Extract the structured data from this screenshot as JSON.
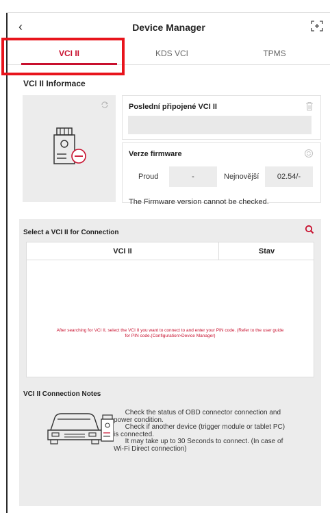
{
  "header": {
    "title": "Device Manager",
    "back_glyph": "‹",
    "icons": {
      "back": "back-chevron-icon",
      "expand": "expand-screen-icon"
    }
  },
  "tabs": [
    {
      "label": "VCI II",
      "active": true
    },
    {
      "label": "KDS VCI",
      "active": false
    },
    {
      "label": "TPMS",
      "active": false
    }
  ],
  "info_section": {
    "title": "VCI II Informace",
    "last_connected": {
      "title": "Poslední připojené VCI II",
      "value": ""
    },
    "firmware": {
      "title": "Verze firmware",
      "current_label": "Proud",
      "current_value": "-",
      "latest_label": "Nejnovější",
      "latest_value": "02.54/-",
      "note": "The Firmware version cannot be checked."
    }
  },
  "select_section": {
    "title": "Select a VCI II for Connection",
    "columns": [
      "VCI II",
      "Stav"
    ],
    "empty_message_line1": "After searching for VCI II, select the VCI II you want to connect to and enter your PIN code. (Refer to the user guide",
    "empty_message_line2": "for PIN code.(Configuration>Device Manager)"
  },
  "notes_section": {
    "title": "VCI II Connection Notes",
    "lines": [
      "      Check the status of OBD connector connection and",
      "power condition.",
      "      Check if another device (trigger module or tablet PC)",
      "is connected.",
      "      It may take up to 30 Seconds to connect. (In case of",
      "Wi-Fi Direct connection)"
    ]
  },
  "colors": {
    "accent": "#c8102e",
    "highlight": "#e8141c",
    "panel": "#ececec"
  }
}
